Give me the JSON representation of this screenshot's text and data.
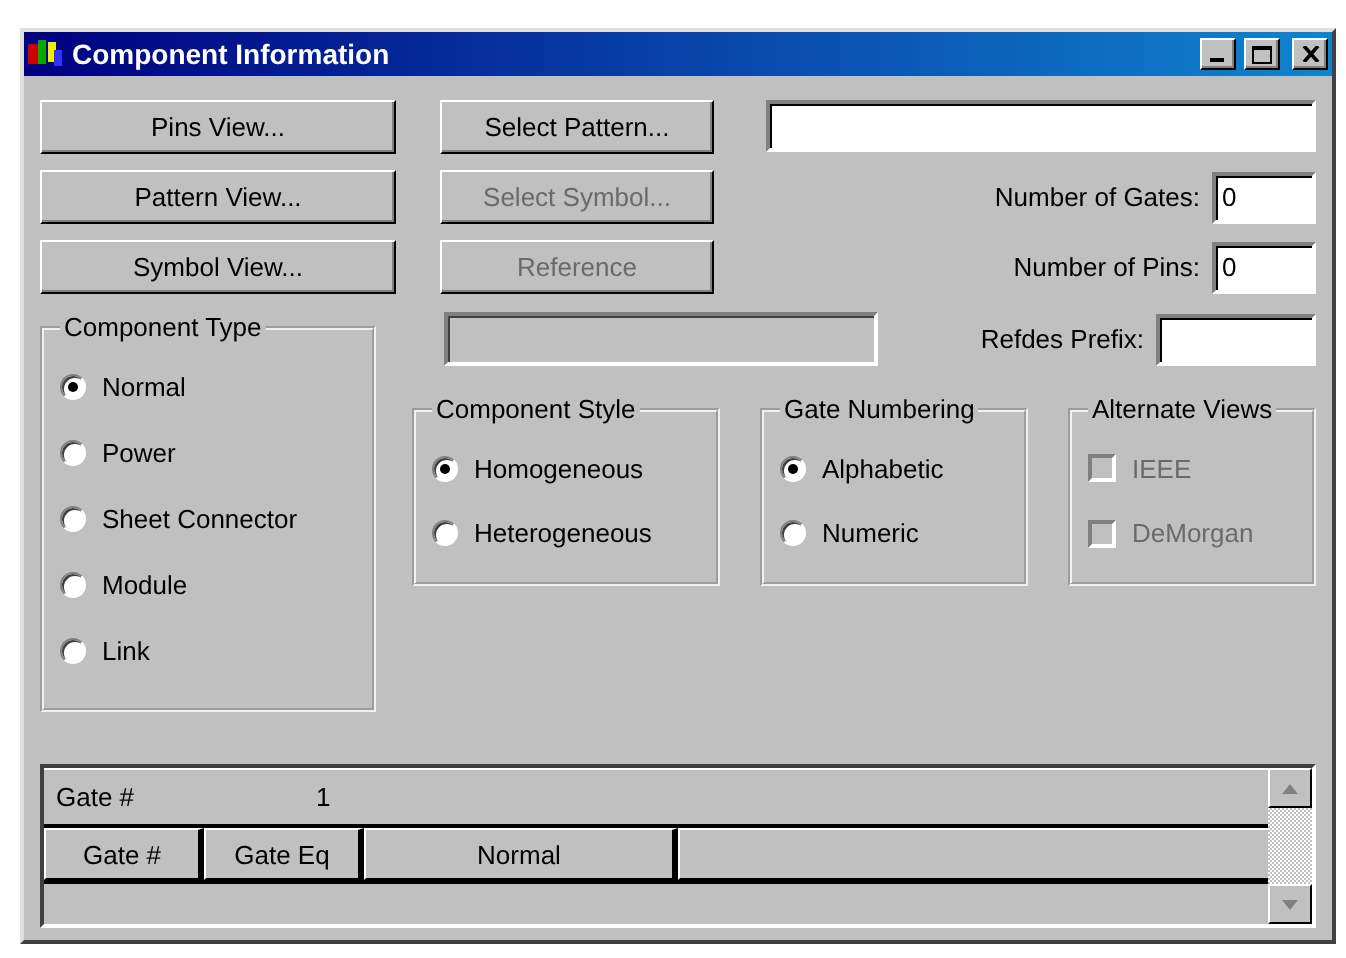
{
  "window": {
    "title": "Component Information"
  },
  "buttons_left": [
    {
      "label": "Pins View...",
      "disabled": false
    },
    {
      "label": "Pattern View...",
      "disabled": false
    },
    {
      "label": "Symbol View...",
      "disabled": false
    }
  ],
  "buttons_middle": [
    {
      "label": "Select Pattern...",
      "disabled": false
    },
    {
      "label": "Select Symbol...",
      "disabled": true
    },
    {
      "label": "Reference",
      "disabled": true
    }
  ],
  "fields": [
    {
      "label": "Number of Gates:",
      "value": "0"
    },
    {
      "label": "Number of Pins:",
      "value": "0"
    },
    {
      "label": "Refdes Prefix:"
    }
  ],
  "component_type": {
    "title": "Component Type",
    "options": [
      {
        "label": "Normal",
        "selected": true
      },
      {
        "label": "Power",
        "selected": false
      },
      {
        "label": "Sheet Connector",
        "selected": false
      },
      {
        "label": "Module",
        "selected": false
      },
      {
        "label": "Link",
        "selected": false
      }
    ]
  },
  "component_style": {
    "title": "Component Style",
    "options": [
      {
        "label": "Homogeneous",
        "selected": true
      },
      {
        "label": "Heterogeneous",
        "selected": false
      }
    ]
  },
  "gate_numbering": {
    "title": "Gate Numbering",
    "options": [
      {
        "label": "Alphabetic",
        "selected": true
      },
      {
        "label": "Numeric",
        "selected": false
      }
    ]
  },
  "alternate_views": {
    "title": "Alternate Views",
    "options": [
      {
        "label": "IEEE",
        "checked": false,
        "disabled": true
      },
      {
        "label": "DeMorgan",
        "checked": false,
        "disabled": true
      }
    ]
  },
  "gate_grid": {
    "row_label": "Gate #",
    "row_value": "1",
    "columns": [
      "Gate #",
      "Gate Eq",
      "Normal"
    ]
  }
}
